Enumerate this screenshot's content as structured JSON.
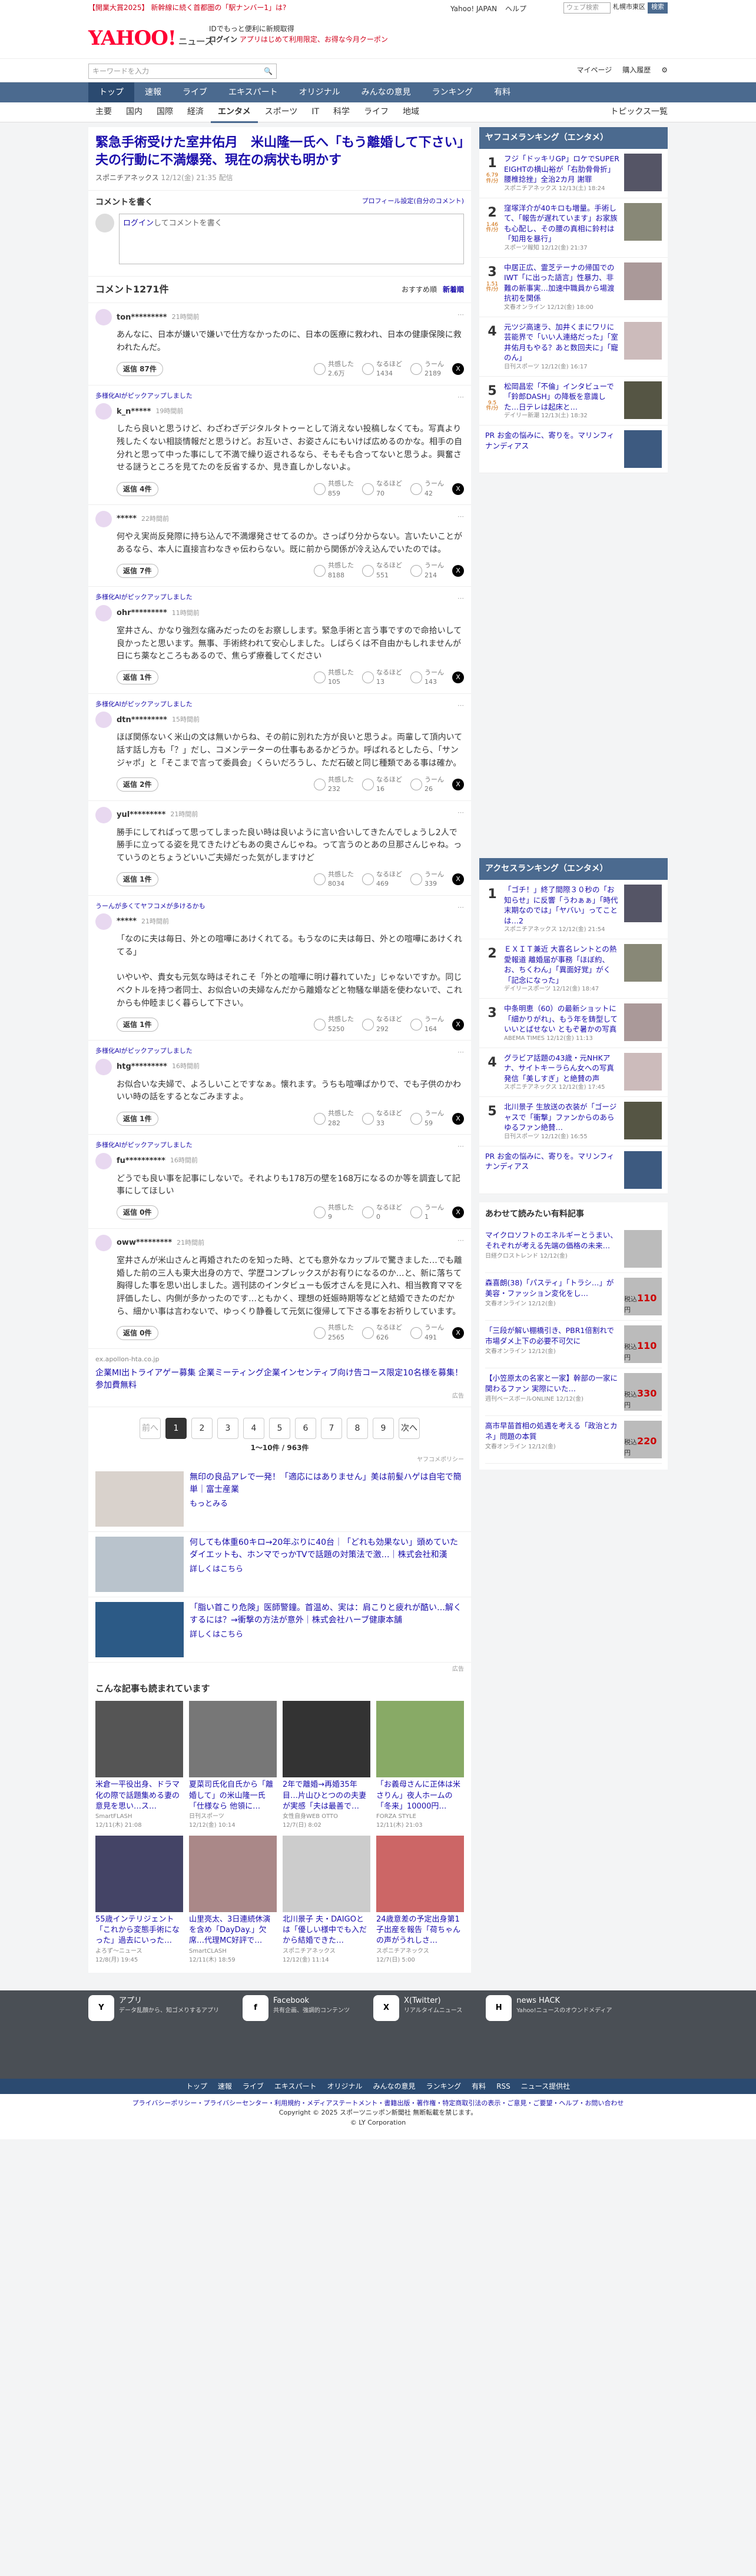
{
  "header": {
    "promo": "【開業大賞2025】 新幹線に続く首都圏の「駅ナンバー1」は?",
    "logo": "YAHOO!",
    "logo_sub": "ニュース",
    "promo_line1": "IDでもっと便利に新規取得",
    "promo_line2": "ログイン",
    "promo_line3": "アプリはじめて利用限定、お得な今月クーポン",
    "toplinks": [
      "Yahoo! JAPAN",
      "ヘルプ"
    ],
    "search_placeholder": "ウェブ検索",
    "search_location": "札幌市東区",
    "search_button": "検索"
  },
  "search": {
    "placeholder": "キーワードを入力",
    "links": [
      "マイページ",
      "購入履歴"
    ]
  },
  "mainnav": [
    "トップ",
    "速報",
    "ライブ",
    "エキスパート",
    "オリジナル",
    "みんなの意見",
    "ランキング",
    "有料"
  ],
  "subnav": [
    "主要",
    "国内",
    "国際",
    "経済",
    "エンタメ",
    "スポーツ",
    "IT",
    "科学",
    "ライフ",
    "地域"
  ],
  "subnav_active": "エンタメ",
  "topics": "トピックス一覧",
  "article": {
    "title": "緊急手術受けた室井佑月　米山隆一氏へ「もう離婚して下さい」夫の行動に不満爆発、現在の病状も明かす",
    "source": "スポニチアネックス",
    "time": "12/12(金) 21:35 配信"
  },
  "comment_box": {
    "title": "コメントを書く",
    "profile_link": "プロフィール設定(自分のコメント)",
    "login_link": "ログイン",
    "textarea": "してコメントを書く"
  },
  "comments_head": {
    "count": "コメント1271件",
    "sort": [
      "おすすめ順",
      "新着順"
    ]
  },
  "comments": [
    {
      "ai": "",
      "user": "ton*********",
      "time": "21時間前",
      "body": "あんなに、日本が嫌いで嫌いで仕方なかったのに、日本の医療に救われ、日本の健康保険に救われたんだ。",
      "reply": "返信 87件",
      "r1": "共感した",
      "r1n": "2.6万",
      "r2": "なるほど",
      "r2n": "1434",
      "r3": "うーん",
      "r3n": "2189"
    },
    {
      "ai": "多様化AIがピックアップしました",
      "user": "k_n*****",
      "time": "19時間前",
      "body": "したら良いと思うけど、わざわざデジタルタトゥーとして消えない投稿しなくても。写真より残したくない相談情報だと思うけど。お互いさ、お姿さんにもいけば広めるのかな。相手の自分れと思って中った事にして不満で繰り返されるなら、そもそも合ってないと思うよ。興奮させる謎うところを見てたのを反省するか、見き直しかしないよ。",
      "reply": "返信 4件",
      "r1": "共感した",
      "r1n": "859",
      "r2": "なるほど",
      "r2n": "70",
      "r3": "うーん",
      "r3n": "42"
    },
    {
      "ai": "",
      "user": "*****",
      "time": "22時間前",
      "body": "何やえ実尚反発際に持ち込んで不満爆発させてるのか。さっぱり分からない。言いたいことがあるなら、本人に直接言わなきゃ伝わらない。既に前から関係が冷え込んでいたのでは。",
      "reply": "返信 7件",
      "r1": "共感した",
      "r1n": "8188",
      "r2": "なるほど",
      "r2n": "551",
      "r3": "うーん",
      "r3n": "214"
    },
    {
      "ai": "多様化AIがピックアップしました",
      "user": "ohr*********",
      "time": "11時間前",
      "body": "室井さん、かなり強烈な痛みだったのをお察しします。緊急手術と言う事ですので命拾いして良かったと思います。無事、手術終われて安心しました。しばらくは不自由かもしれませんが日にち薬なところもあるので、焦らず療養してください",
      "reply": "返信 1件",
      "r1": "共感した",
      "r1n": "105",
      "r2": "なるほど",
      "r2n": "13",
      "r3": "うーん",
      "r3n": "143"
    },
    {
      "ai": "多様化AIがピックアップしました",
      "user": "dtn*********",
      "time": "15時間前",
      "body": "ほぼ関係ないく米山の文は無いからね、その前に別れた方が良いと思うよ。両輩して頂内いて話す話し方も「？」だし、コメンテーターの仕事もあるかどうか。呼ばれるとしたら、「サンジャポ」と「そこまで言って委員会」くらいだろうし、ただ石破と同じ種類である事は確か。",
      "reply": "返信 2件",
      "r1": "共感した",
      "r1n": "232",
      "r2": "なるほど",
      "r2n": "16",
      "r3": "うーん",
      "r3n": "26"
    },
    {
      "ai": "",
      "user": "yul*********",
      "time": "21時間前",
      "body": "勝手にしてればって思ってしまった良い時は良いように言い合いしてきたんでしょうし2人で勝手に立ってる姿を見てきたけどもあの奥さんじゃね。って言うのとあの旦那さんじゃね。っていうのとちょうどいいご夫婦だった気がしますけど",
      "reply": "返信 1件",
      "r1": "共感した",
      "r1n": "8034",
      "r2": "なるほど",
      "r2n": "469",
      "r3": "うーん",
      "r3n": "339"
    },
    {
      "ai": "うーんが多くてヤフコメが多けるかも",
      "user": "*****",
      "time": "21時間前",
      "body": "「なのに夫は毎日、外との喧嘩にあけくれてる。もうなのに夫は毎日、外との喧嘩にあけくれてる」\n\nいやいや、貴女も元気な時はそれこそ「外との喧嘩に明け暮れていた」じゃないですか。同じベクトルを持つ者同士、お似合いの夫婦なんだから離婚などと物騒な単語を使わないで、これからも仲睦まじく暮らして下さい。",
      "reply": "返信 1件",
      "r1": "共感した",
      "r1n": "5250",
      "r2": "なるほど",
      "r2n": "292",
      "r3": "うーん",
      "r3n": "164"
    },
    {
      "ai": "多様化AIがピックアップしました",
      "user": "htg*********",
      "time": "16時間前",
      "body": "お似合いな夫婦で、よろしいことですなぁ。懐れます。うちも喧嘩ばかりで、でも子供のかわいい時の話をするとなごみますよ。",
      "reply": "返信 1件",
      "r1": "共感した",
      "r1n": "282",
      "r2": "なるほど",
      "r2n": "33",
      "r3": "うーん",
      "r3n": "59"
    },
    {
      "ai": "多様化AIがピックアップしました",
      "user": "fu**********",
      "time": "16時間前",
      "body": "どうでも良い事を記事にしないで。それよりも178万の壁を168万になるのか等を調査して記事にしてほしい",
      "reply": "返信 0件",
      "r1": "共感した",
      "r1n": "9",
      "r2": "なるほど",
      "r2n": "0",
      "r3": "うーん",
      "r3n": "1"
    },
    {
      "ai": "",
      "user": "oww*********",
      "time": "21時間前",
      "body": "室井さんが米山さんと再婚されたのを知った時、とても意外なカップルで驚きました…でも離婚した前の三人も東大出身の方で、学歴コンプレックスがお有りになるのか…と、新に落ちて胸得した事を思い出しました。週刊誌のインタビューも仮才さんを見に入れ、相当教育ママを評価したし、内側が多かったのです…ともかく、理想の妊娠時期等などと結婚できたのだから、細かい事は言わないで、ゆっくり静養して元気に復帰して下さる事をお祈りしています。",
      "reply": "返信 0件",
      "r1": "共感した",
      "r1n": "2565",
      "r2": "なるほど",
      "r2n": "626",
      "r3": "うーん",
      "r3n": "491"
    }
  ],
  "ad_block": {
    "domain": "ex.apollon-hta.co.jp",
    "title": "企業MI出トライアゲー募集 企業ミーティング企業インセンティブ向け告コース限定10名様を募集！参加費無料",
    "label": "広告"
  },
  "pager": {
    "prev": "前へ",
    "pages": [
      "1",
      "2",
      "3",
      "4",
      "5",
      "6",
      "7",
      "8",
      "9"
    ],
    "next": "次へ",
    "info": "1～10件 / 963件"
  },
  "yad_label": "ヤフコメポリシー",
  "promo_ads": [
    {
      "title": "無印の良品アレで一発！「適応にはありません」美は前髪ハゲは自宅で簡単｜富士産業",
      "sub": "もっとみる"
    },
    {
      "title": "何しても体重60キロ→20年ぶりに40台｜「どれも効果ない」頭めていたダイエットも、ホンマでっかTVで話題の対策法で激…｜株式会社和漢",
      "sub": "詳しくはこちら"
    },
    {
      "title": "「脂い首こり危険」医師警鐘。首温め、実は：肩こりと疲れが酷い…解くするには？→衝撃の方法が意外｜株式会社ハーブ健康本舗",
      "sub": "詳しくはこちら"
    }
  ],
  "promo_label": "広告",
  "others": {
    "title": "こんな記事も読まれています",
    "cards": [
      {
        "title": "米倉一平役出身、ドラマ化の際で話題集める妻の意見を思い…ス…",
        "src": "SmartFLASH",
        "time": "12/11(木) 21:08"
      },
      {
        "title": "夏菜司氏化自氏から「離婚して」の米山隆一氏「仕様なら 他領に…",
        "src": "日刊スポーツ",
        "time": "12/12(金) 10:14"
      },
      {
        "title": "2年で離婚→再婚35年目…片山ひとつのの夫妻が実感「夫は最善で…",
        "src": "女性自身WEB OTTO",
        "time": "12/7(日) 8:02"
      },
      {
        "title": "「お義母さんに正体は米さりん」夜人ホームの「冬来」10000円…",
        "src": "FORZA STYLE",
        "time": "12/11(木) 21:03"
      },
      {
        "title": "55歳インテリジェント「これから変態手術になった」過去にいった…",
        "src": "よろず〜ニュース",
        "time": "12/8(月) 19:45"
      },
      {
        "title": "山里亮太、3日連続休演を含め「DayDay.」欠席…代理MC好評で…",
        "src": "SmartCLASH",
        "time": "12/11(木) 18:59"
      },
      {
        "title": "北川景子 夫・DAIGOとは「優しい様中でも入だから結婚できた…",
        "src": "スポニチアネックス",
        "time": "12/12(金) 11:14"
      },
      {
        "title": "24歳意差の予定出身第1子出産を報告「荷ちゃんの声がうれしさ…",
        "src": "スポニチアネックス",
        "time": "12/7(日) 5:00"
      }
    ]
  },
  "ranking": {
    "title": "ヤフコメランキング（エンタメ）",
    "items": [
      {
        "n": "1",
        "c": "6.79\n件/分",
        "t": "フジ「ドッキリGP」ロケでSUPER EIGHTの横山裕が「右肋骨骨折」腰椎捻挫」全治2カ月 謝罪",
        "s": "スポニチアネックス 12/13(土) 18:24"
      },
      {
        "n": "2",
        "c": "1.46\n件/分",
        "t": "窪塚洋介が40キロも増量。手術して、「報告が遅れています」お家族も心配し、その腰の真相に鈴村は「知用を暴行」",
        "s": "スポーツ報知 12/12(金) 21:37"
      },
      {
        "n": "3",
        "c": "1.51\n件/分",
        "t": "中居正広、霊芝テーナの帰国でのIWT「に出った語言」性暴力、非難の新事実…加速中職員から場渡抗初を関係",
        "s": "文春オンライン 12/12(金) 18:00"
      },
      {
        "n": "4",
        "c": "",
        "t": "元ツジ高速ラ、加井くまにワリに芸能界で「いい人連絡だった」「室井佑月もやる？あと数回夫に」「寵のん」",
        "s": "日刊スポーツ 12/12(金) 16:17"
      },
      {
        "n": "5",
        "c": "9.5\n件/分",
        "t": "松岡昌宏「不倫」インタビューで「鈴郎DASH」の降板を意識した…日テレは起床と…",
        "s": "デイリー新潮 12/13(土) 18:32"
      }
    ],
    "pr": "PR お金の悩みに、寄りを。マリンフィナンディアス"
  },
  "access": {
    "title": "アクセスランキング（エンタメ）",
    "items": [
      {
        "n": "1",
        "t": "「ゴチ！」終了間際３０秒の「お知らせ」に反響「うわぁぁ」「時代末期なのでは」「ヤバい」ってことは…2",
        "s": "スポニチアネックス 12/12(金) 21:54"
      },
      {
        "n": "2",
        "t": "ＥＸＩＴ兼近 大喜名レントとの熱愛報道 離婚届が事務「ほぼ約、お、ちくわん」「異面好覚」がく「記念になった」",
        "s": "デイリースポーツ 12/12(金) 18:47"
      },
      {
        "n": "3",
        "t": "中条明恵（60）の最新ショットに「細かりがれ」、もう年を鋳型していいとばせない ともぞ暑かの写真",
        "s": "ABEMA TIMES 12/12(金) 11:13"
      },
      {
        "n": "4",
        "t": "グラビア話題の43歳・元NHKアナ、サイトキーラらん女への写真発信「美しすぎ」と絶賛の声",
        "s": "スポニチアネックス 12/12(金) 17:45"
      },
      {
        "n": "5",
        "t": "北川景子 生放送の衣装が「ゴージャスで「衝撃」ファンからのあらゆるファン絶賛…",
        "s": "日刊スポーツ 12/12(金) 16:55"
      }
    ],
    "pr": "PR お金の悩みに、寄りを。マリンフィナンディアス"
  },
  "sideads": {
    "title": "あわせて読みたい有料記事",
    "items": [
      {
        "t": "マイクロソフトのエネルギーとうまい、それぞれが考える先端の価格の未来…",
        "s": "日経クロストレンド 12/12(金)",
        "p": ""
      },
      {
        "t": "森喜朗(38)「パスティ」「トラシ…」が美容・ファッション変化をし…",
        "s": "文春オンライン 12/12(金)",
        "p": "110"
      },
      {
        "t": "「三段が解い棚橋引き、PBR1倍割れで市場ダメ上下の必要不可欠に",
        "s": "文春オンライン 12/12(金)",
        "p": "110"
      },
      {
        "t": "【小笠原太の名家と一家】幹部の一家に関わるファン 実際にいた…",
        "s": "週刊ベースボールONLINE 12/12(金)",
        "p": "330"
      },
      {
        "t": "高市早苗首相の処遇を考える「政治とカネ」問題の本質",
        "s": "文春オンライン 12/12(金)",
        "p": "220"
      }
    ]
  },
  "footer": {
    "cols": [
      {
        "title": "アプリ",
        "desc": "データ乱顔から、知ゴメりするアプリ",
        "icon": "Y"
      },
      {
        "title": "Facebook",
        "desc": "共有企画、強調的コンテンツ",
        "icon": "f"
      },
      {
        "title": "X(Twitter)",
        "desc": "リアルタイムニュース",
        "icon": "X"
      },
      {
        "title": "news HACK",
        "desc": "Yahoo!ニュースのオウンドメディア",
        "icon": "H"
      }
    ],
    "nav": [
      "トップ",
      "速報",
      "ライブ",
      "エキスパート",
      "オリジナル",
      "みんなの意見",
      "ランキング",
      "有料",
      "RSS",
      "ニュース提供社"
    ],
    "legal1": "プライバシーポリシー・プライバシーセンター・利用規約・メディアステートメント・書籍出版・著作権・特定商取引法の表示・ご意見・ご要望・ヘルプ・お問い合わせ",
    "copyright": "Copyright © 2025 スポーツニッポン新聞社 無断転載を禁じます。",
    "corp": "© LY Corporation"
  },
  "icons": {
    "search": "magnifier-icon",
    "settings": "gear-icon"
  },
  "colors": {
    "nav": "#4b6a8f",
    "link": "#1a0dab",
    "accent": "#ff0033"
  }
}
